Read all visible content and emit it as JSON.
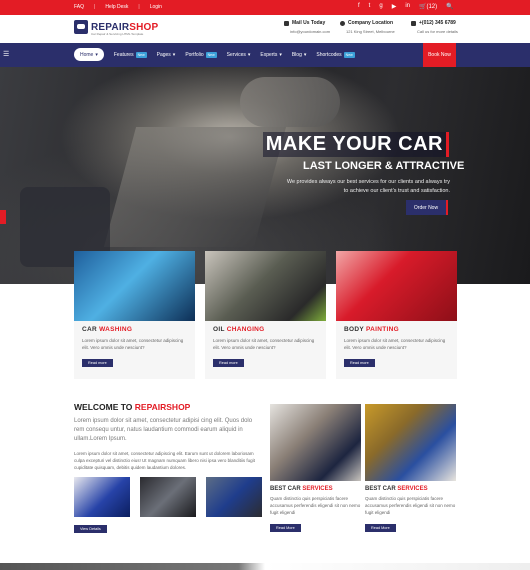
{
  "topbar": {
    "links": [
      "FAQ",
      "Help Desk",
      "Login"
    ],
    "cart": "(12)",
    "social_icons": [
      "facebook-icon",
      "twitter-icon",
      "google-plus-icon",
      "youtube-icon",
      "linkedin-icon",
      "cart-icon",
      "search-icon"
    ]
  },
  "logo": {
    "part1": "REPAIR",
    "part2": "SHOP",
    "tagline": "Car Repair & Servicing HTML Template"
  },
  "contacts": [
    {
      "title": "Mail Us Today",
      "sub": "info@yourdomain.com"
    },
    {
      "title": "Company Location",
      "sub": "121 King Street, Melbourne"
    },
    {
      "title": "+(012) 345 6789",
      "sub": "Call us for more details"
    }
  ],
  "nav": {
    "items": [
      {
        "label": "Home",
        "badge": ""
      },
      {
        "label": "Features",
        "badge": "New"
      },
      {
        "label": "Pages",
        "badge": ""
      },
      {
        "label": "Portfolio",
        "badge": "New"
      },
      {
        "label": "Services",
        "badge": ""
      },
      {
        "label": "Experts",
        "badge": ""
      },
      {
        "label": "Blog",
        "badge": ""
      },
      {
        "label": "Shortcodes",
        "badge": "New"
      }
    ],
    "book": "Book Now"
  },
  "hero": {
    "title": "MAKE YOUR CAR",
    "subtitle": "LAST LONGER & ATTRACTIVE",
    "text": "We provides always our best services for our clients and always try to achieve our client's trust and satisfaction.",
    "button": "Order Now"
  },
  "cards": [
    {
      "h1": "CAR",
      "h2": "WASHING",
      "text": "Lorem ipsum dolor sit amet, consectetur adipiscing elit. Vero omnis unde nesciunt?",
      "button": "Read more"
    },
    {
      "h1": "OIL",
      "h2": "CHANGING",
      "text": "Lorem ipsum dolor sit amet, consectetur adipiscing elit. Vero omnis unde nesciunt?",
      "button": "Read more"
    },
    {
      "h1": "BODY",
      "h2": "PAINTING",
      "text": "Lorem ipsum dolor sit amet, consectetur adipiscing elit. Vero omnis unde nesciunt?",
      "button": "Read more"
    }
  ],
  "welcome": {
    "h1": "WELCOME TO",
    "h2": "REPAIRSHOP",
    "lead": "Lorem ipsum dolor sit amet, consectetur adipisi cing elit. Quos dolo rem consequ untur, natus laudantium commodi earum aliquid in ullam.Lorem Ipsum.",
    "text": "Lorem ipsum dolor sit amet, consectetur adipiscing elit. Earum sunt ut dolorem laboriosam culpa excepturi vel distinctio eius! Ut magnam numquam libero nisi ipsa vero blanditiis fugit cupiditate quisquam, debitis quidem laudantium dolores.",
    "button": "View Details"
  },
  "best": [
    {
      "h1": "BEST CAR",
      "h2": "SERVICES",
      "text": "Quam distinctio quis perspiciatis facere accusamus perferendis eligendi sit non nemo fugit eligendi",
      "button": "Read More"
    },
    {
      "h1": "BEST CAR",
      "h2": "SERVICES",
      "text": "Quam distinctio quis perspiciatis facere accusamus perferendis eligendi sit non nemo fugit eligendi",
      "button": "Read More"
    }
  ],
  "colors": {
    "primary": "#2b2f6b",
    "accent": "#e31c25"
  }
}
